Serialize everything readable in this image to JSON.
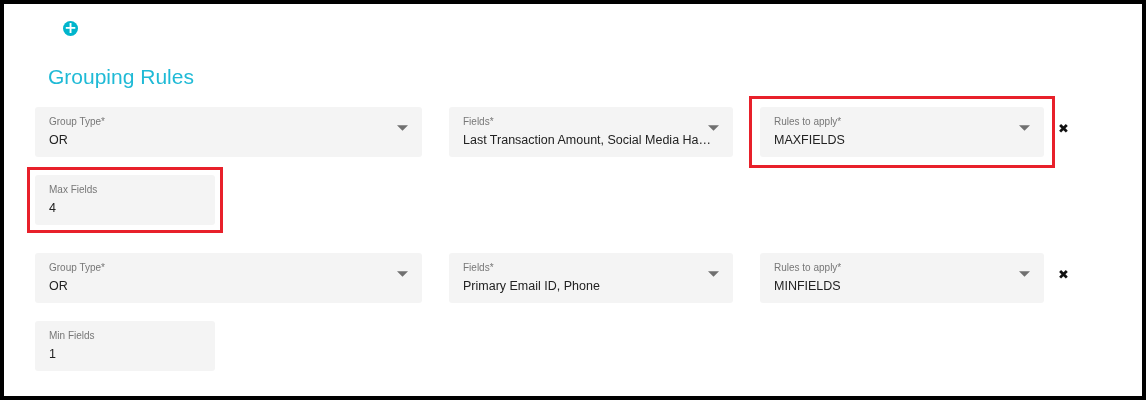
{
  "add_button": {
    "label": "+"
  },
  "title": "Grouping Rules",
  "groups": [
    {
      "selects": [
        {
          "label": "Group Type*",
          "value": "OR",
          "highlighted": false
        },
        {
          "label": "Fields*",
          "value": "Last Transaction Amount, Social Media Ha…",
          "highlighted": false
        },
        {
          "label": "Rules to apply*",
          "value": "MAXFIELDS",
          "highlighted": true
        }
      ],
      "remove": "✖",
      "limit": {
        "label": "Max Fields",
        "value": "4",
        "highlighted": true
      }
    },
    {
      "selects": [
        {
          "label": "Group Type*",
          "value": "OR",
          "highlighted": false
        },
        {
          "label": "Fields*",
          "value": "Primary Email ID, Phone",
          "highlighted": false
        },
        {
          "label": "Rules to apply*",
          "value": "MINFIELDS",
          "highlighted": false
        }
      ],
      "remove": "✖",
      "limit": {
        "label": "Min Fields",
        "value": "1",
        "highlighted": false
      }
    }
  ]
}
